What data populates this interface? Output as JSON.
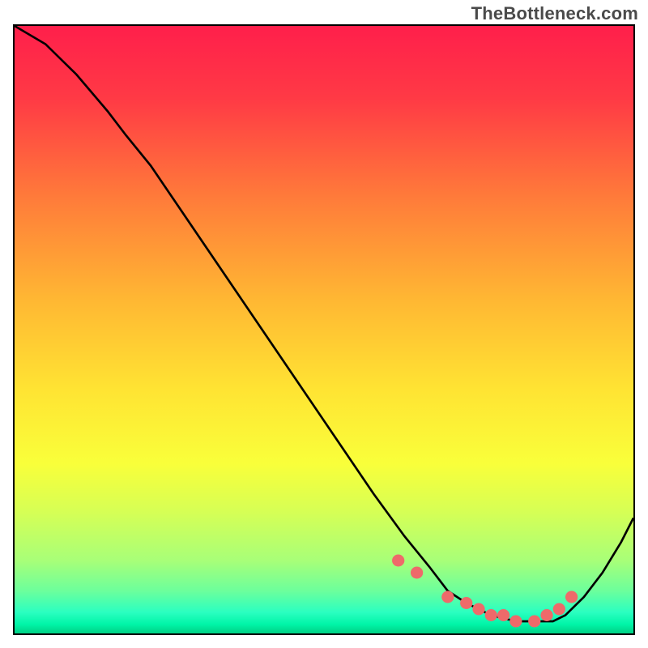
{
  "watermark": "TheBottleneck.com",
  "chart_data": {
    "type": "line",
    "title": "",
    "xlabel": "",
    "ylabel": "",
    "xlim": [
      0,
      100
    ],
    "ylim": [
      0,
      100
    ],
    "curve": {
      "x": [
        0,
        5,
        10,
        15,
        18,
        22,
        28,
        34,
        40,
        46,
        52,
        58,
        63,
        67,
        70,
        73,
        77,
        81,
        84,
        87,
        89,
        92,
        95,
        98,
        100
      ],
      "y": [
        100,
        97,
        92,
        86,
        82,
        77,
        68,
        59,
        50,
        41,
        32,
        23,
        16,
        11,
        7,
        5,
        3,
        2,
        2,
        2,
        3,
        6,
        10,
        15,
        19
      ]
    },
    "markers": {
      "x": [
        62,
        65,
        70,
        73,
        75,
        77,
        79,
        81,
        84,
        86,
        88,
        90
      ],
      "y": [
        12,
        10,
        6,
        5,
        4,
        3,
        3,
        2,
        2,
        3,
        4,
        6
      ]
    },
    "gradient_stops": [
      {
        "offset": 0.0,
        "color": "#ff1f4b"
      },
      {
        "offset": 0.12,
        "color": "#ff3a45"
      },
      {
        "offset": 0.28,
        "color": "#ff7a3a"
      },
      {
        "offset": 0.45,
        "color": "#ffb733"
      },
      {
        "offset": 0.6,
        "color": "#ffe433"
      },
      {
        "offset": 0.72,
        "color": "#f9ff3a"
      },
      {
        "offset": 0.8,
        "color": "#d6ff55"
      },
      {
        "offset": 0.88,
        "color": "#a8ff78"
      },
      {
        "offset": 0.93,
        "color": "#6cff9c"
      },
      {
        "offset": 0.965,
        "color": "#2bffc0"
      },
      {
        "offset": 0.985,
        "color": "#00f5a8"
      },
      {
        "offset": 1.0,
        "color": "#00d084"
      }
    ],
    "marker_color": "#ee6a6a",
    "curve_color": "#000000"
  }
}
